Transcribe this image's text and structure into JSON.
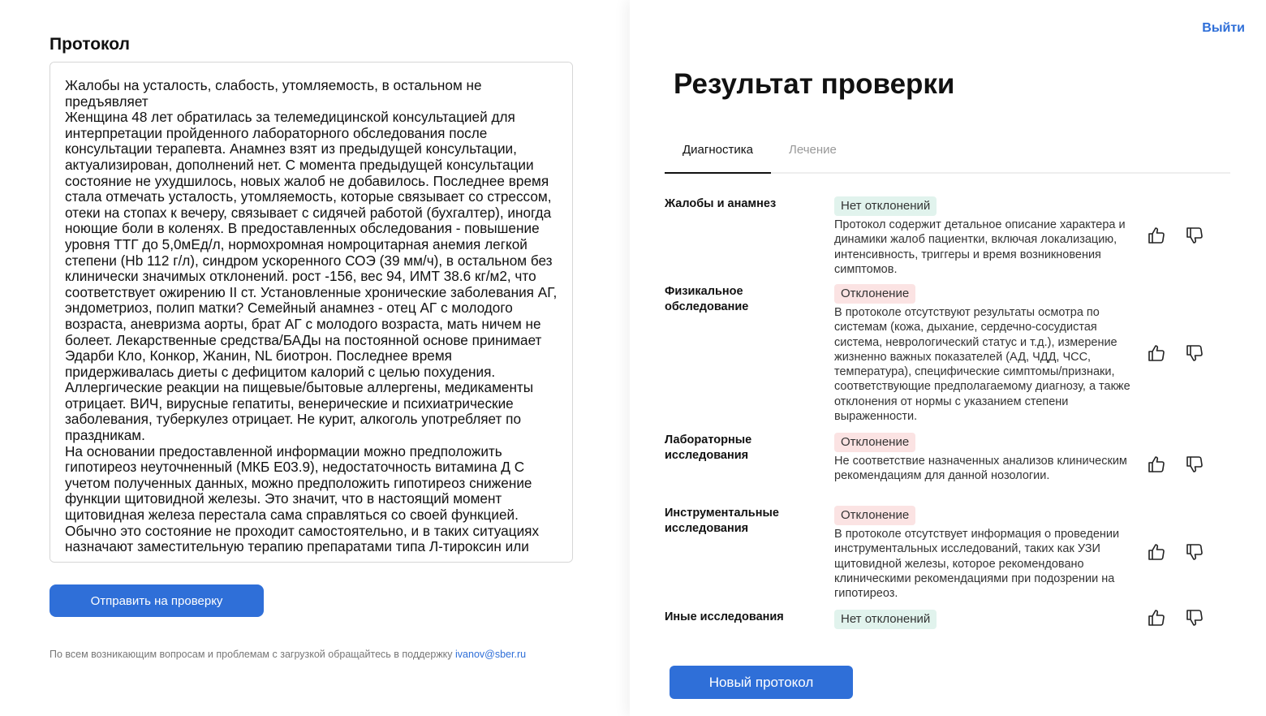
{
  "protocol": {
    "title": "Протокол",
    "text": "Жалобы на усталость, слабость, утомляемость, в остальном не предъявляет\nЖенщина 48 лет обратилась за телемедицинской консультацией для интерпретации пройденного лабораторного обследования после консультации терапевта. Анамнез взят из предыдущей консультации, актуализирован, дополнений нет. С момента предыдущей консультации состояние не ухудшилось, новых жалоб не добавилось. Последнее время стала отмечать усталость, утомляемость, которые связывает со стрессом, отеки на стопах к вечеру, связывает с сидячей работой (бухгалтер), иногда ноющие боли в коленях. В предоставленных обследования - повышение уровня ТТГ до 5,0мЕд/л, нормохромная номроцитарная анемия легкой степени (Нb 112 г/л), синдром ускоренного СОЭ (39 мм/ч), в остальном без клинически значимых отклонений. рост -156, вес 94, ИМТ 38.6 кг/м2, что соответствует ожирению II ст. Установленные хронические заболевания АГ, эндометриоз, полип матки? Семейный анамнез - отец АГ с молодого возраста, аневризма аорты, брат АГ с молодого возраста, мать ничем не болеет. Лекарственные средства/БАДы на постоянной основе принимает Эдарби Кло, Конкор, Жанин, NL биотрон. Последнее время придерживалась диеты с дефицитом калорий с целью похудения. Аллергические реакции на пищевые/бытовые аллергены, медикаменты отрицает. ВИЧ, вирусные гепатиты, венерические и психиатрические заболевания, туберкулез отрицает. Не курит, алкоголь употребляет по праздникам.\nНа основании предоставленной информации можно предположить гипотиреоз неуточненный (МКБ Е03.9), недостаточность витамина Д С учетом полученных данных, можно предположить гипотиреоз снижение функции щитовидной железы. Это значит, что в настоящий момент щитовидная железа перестала сама справляться со своей функцией. Обычно это состояние не проходит самостоятельно, и в таких ситуациях назначают заместительную терапию препаратами типа Л-тироксин или",
    "send_button": "Отправить на проверку",
    "support_text": "По всем возникающим вопросам и проблемам с загрузкой обращайтесь в поддержку",
    "support_email": "ivanov@sber.ru"
  },
  "header": {
    "logout": "Выйти"
  },
  "result": {
    "title": "Результат проверки",
    "tabs": [
      "Диагностика",
      "Лечение"
    ],
    "rows": [
      {
        "label": "Жалобы и анамнез",
        "status": "Нет отклонений",
        "status_type": "ok",
        "description": "Протокол содержит детальное описание характера и динамики жалоб пациентки, включая локализацию, интенсивность, триггеры и время возникновения симптомов."
      },
      {
        "label": "Физикальное обследование",
        "status": "Отклонение",
        "status_type": "deviation",
        "description": "В протоколе отсутствуют результаты осмотра по системам (кожа, дыхание, сердечно-сосудистая система, неврологический статус и т.д.), измерение жизненно важных показателей (АД, ЧДД, ЧСС, температура), специфические симптомы/признаки, соответствующие предполагаемому диагнозу, а также отклонения от нормы с указанием степени выраженности."
      },
      {
        "label": "Лабораторные исследования",
        "status": "Отклонение",
        "status_type": "deviation",
        "description": "Не соответствие назначенных анализов клиническим рекомендациям для данной нозологии."
      },
      {
        "label": "Инструментальные исследования",
        "status": "Отклонение",
        "status_type": "deviation",
        "description": "В протоколе отсутствует информация о проведении инструментальных исследований, таких как УЗИ щитовидной железы, которое рекомендовано клиническими рекомендациями при подозрении на гипотиреоз."
      },
      {
        "label": "Иные исследования",
        "status": "Нет отклонений",
        "status_type": "ok",
        "description": ""
      }
    ],
    "new_button": "Новый протокол"
  },
  "colors": {
    "accent": "#2f6fd8",
    "badge_ok_bg": "#e1f3ed",
    "badge_deviation_bg": "#fbe3e3"
  },
  "icons": {
    "like": "thumbs-up-icon",
    "dislike": "thumbs-down-icon"
  }
}
